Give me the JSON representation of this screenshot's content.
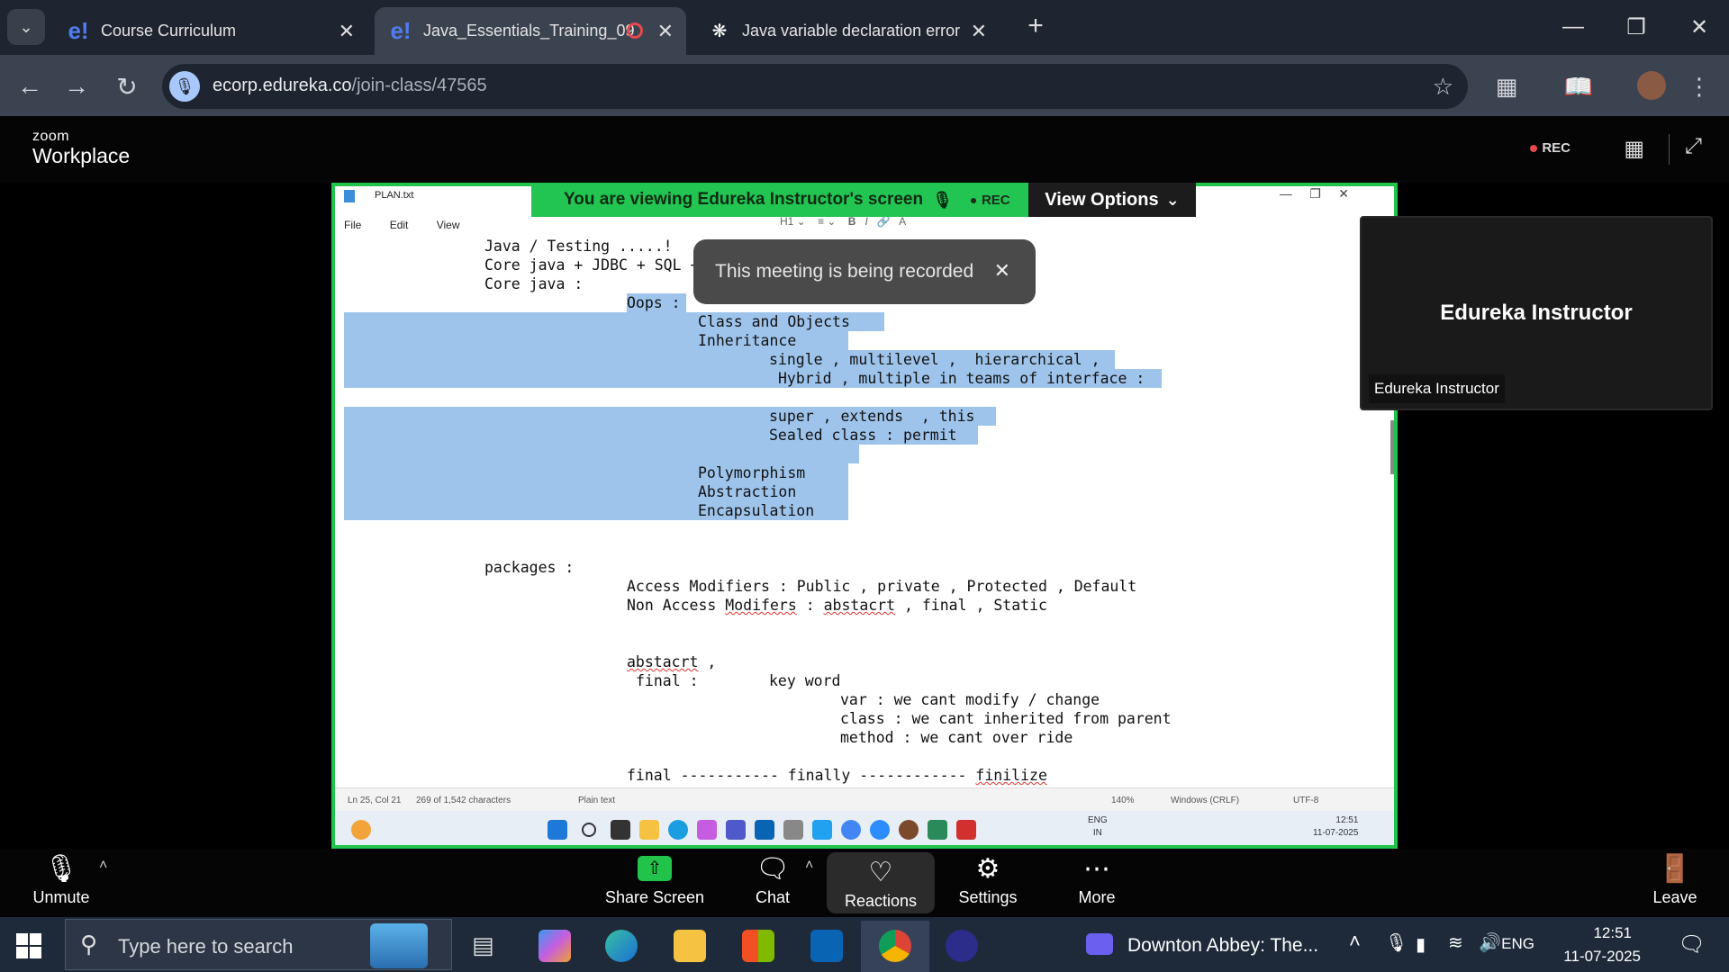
{
  "browser": {
    "tabs": [
      {
        "title": "Course Curriculum",
        "icon": "edureka-icon"
      },
      {
        "title": "Java_Essentials_Training_09",
        "icon": "edureka-icon",
        "recording": true
      },
      {
        "title": "Java variable declaration error",
        "icon": "chatgpt-icon"
      }
    ],
    "url_domain": "ecorp.edureka.co",
    "url_path": "/join-class/47565"
  },
  "zoom": {
    "brand_small": "zoom",
    "brand_big": "Workplace",
    "rec_label": "REC",
    "banner_text": "You are viewing  Edureka Instructor's screen",
    "banner_rec": "REC",
    "view_options": "View Options",
    "toast_text": "This meeting is being recorded",
    "participant_name": "Edureka Instructor",
    "participant_label": "Edureka Instructor",
    "controls": {
      "unmute": "Unmute",
      "share": "Share Screen",
      "chat": "Chat",
      "reactions": "Reactions",
      "settings": "Settings",
      "more": "More",
      "leave": "Leave"
    }
  },
  "notepad": {
    "title": "PLAN.txt",
    "menu": [
      "File",
      "Edit",
      "View"
    ],
    "lines": [
      "Java / Testing .....!",
      "Core java + JDBC + SQL +",
      "Core java :",
      "Oops :",
      "Class and Objects",
      "Inheritance",
      "single , multilevel ,  hierarchical ,",
      "Hybrid , multiple in teams of interface :",
      "super , extends  , this",
      "Sealed class : permit",
      "Polymorphism",
      "Abstraction",
      "Encapsulation",
      "packages :",
      "Access Modifiers : Public , private , Protected , Default",
      "Non Access ",
      "Modifers",
      " : ",
      "abstacrt",
      " , final , Static",
      "abstacrt",
      " ,",
      "final :",
      "key word",
      "var : we cant modify / change",
      "class : we cant inherited from parent",
      "method : we cant over ride",
      "final ----------- finally ------------ ",
      "finilize"
    ],
    "status": {
      "position": "Ln 25, Col 21",
      "chars": "269 of 1,542 characters",
      "format": "Plain text",
      "zoom": "140%",
      "eol": "Windows (CRLF)",
      "encoding": "UTF-8"
    },
    "inner_clock_time": "12:51",
    "inner_clock_date": "11-07-2025",
    "inner_lang": "ENG",
    "inner_region": "IN"
  },
  "taskbar": {
    "search_placeholder": "Type here to search",
    "media": "Downton Abbey: The...",
    "lang": "ENG",
    "time": "12:51",
    "date": "11-07-2025"
  },
  "colors": {
    "share_border": "#22c34a",
    "highlight": "#9ec4ec",
    "banner": "#23c552"
  }
}
